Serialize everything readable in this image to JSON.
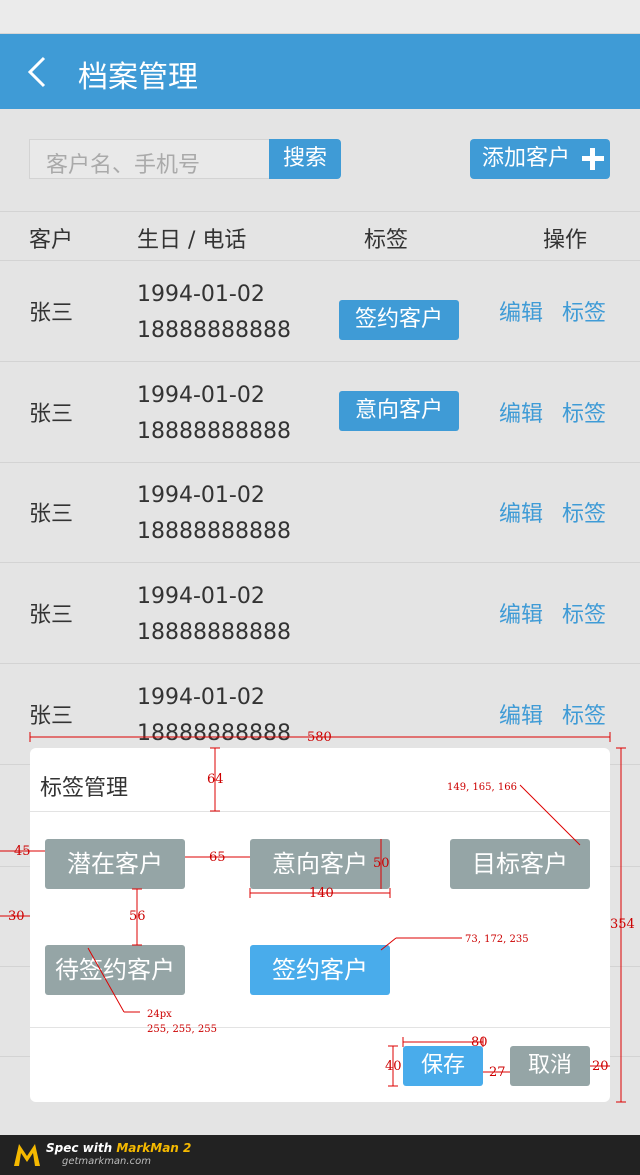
{
  "header": {
    "title": "档案管理"
  },
  "search": {
    "placeholder": "客户名、手机号",
    "button": "搜索"
  },
  "add_button": "添加客户",
  "table": {
    "columns": [
      "客户",
      "生日 / 电话",
      "标签",
      "操作"
    ],
    "rows": [
      {
        "name": "张三",
        "birthday": "1994-01-02",
        "phone": "18888888888",
        "tag": "签约客户",
        "edit": "编辑",
        "label": "标签"
      },
      {
        "name": "张三",
        "birthday": "1994-01-02",
        "phone": "18888888888",
        "tag": "意向客户",
        "edit": "编辑",
        "label": "标签"
      },
      {
        "name": "张三",
        "birthday": "1994-01-02",
        "phone": "18888888888",
        "tag": "",
        "edit": "编辑",
        "label": "标签"
      },
      {
        "name": "张三",
        "birthday": "1994-01-02",
        "phone": "18888888888",
        "tag": "",
        "edit": "编辑",
        "label": "标签"
      },
      {
        "name": "张三",
        "birthday": "1994-01-02",
        "phone": "18888888888",
        "tag": "",
        "edit": "编辑",
        "label": "标签"
      }
    ]
  },
  "modal": {
    "title": "标签管理",
    "chips": {
      "potential": "潜在客户",
      "intent": "意向客户",
      "target": "目标客户",
      "pending": "待签约客户",
      "signed": "签约客户"
    },
    "save": "保存",
    "cancel": "取消"
  },
  "annotations": {
    "width_580": "580",
    "height_64": "64",
    "height_354": "354",
    "left_45": "45",
    "gap_65": "65",
    "height_50": "50",
    "width_140": "140",
    "left_30": "30",
    "gap_56": "56",
    "color_grey": "149, 165, 166",
    "color_blue": "73, 172, 235",
    "font_size": "24px",
    "font_color": "255, 255, 255",
    "width_80": "80",
    "height_40": "40",
    "gap_27": "27",
    "right_20": "20"
  },
  "colors": {
    "primary": "#3f9bd6",
    "chip_grey": "#95a5a6",
    "chip_blue": "#49ACEB"
  },
  "footer": {
    "brand_prefix": "Spec with ",
    "brand_name": "MarkMan 2",
    "site": "getmarkman.com"
  }
}
